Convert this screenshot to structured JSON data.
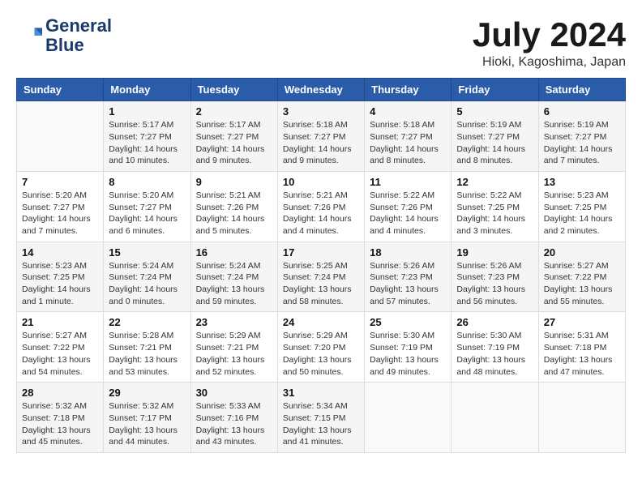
{
  "header": {
    "logo_line1": "General",
    "logo_line2": "Blue",
    "month_year": "July 2024",
    "location": "Hioki, Kagoshima, Japan"
  },
  "weekdays": [
    "Sunday",
    "Monday",
    "Tuesday",
    "Wednesday",
    "Thursday",
    "Friday",
    "Saturday"
  ],
  "weeks": [
    [
      {
        "day": "",
        "info": ""
      },
      {
        "day": "1",
        "info": "Sunrise: 5:17 AM\nSunset: 7:27 PM\nDaylight: 14 hours\nand 10 minutes."
      },
      {
        "day": "2",
        "info": "Sunrise: 5:17 AM\nSunset: 7:27 PM\nDaylight: 14 hours\nand 9 minutes."
      },
      {
        "day": "3",
        "info": "Sunrise: 5:18 AM\nSunset: 7:27 PM\nDaylight: 14 hours\nand 9 minutes."
      },
      {
        "day": "4",
        "info": "Sunrise: 5:18 AM\nSunset: 7:27 PM\nDaylight: 14 hours\nand 8 minutes."
      },
      {
        "day": "5",
        "info": "Sunrise: 5:19 AM\nSunset: 7:27 PM\nDaylight: 14 hours\nand 8 minutes."
      },
      {
        "day": "6",
        "info": "Sunrise: 5:19 AM\nSunset: 7:27 PM\nDaylight: 14 hours\nand 7 minutes."
      }
    ],
    [
      {
        "day": "7",
        "info": "Sunrise: 5:20 AM\nSunset: 7:27 PM\nDaylight: 14 hours\nand 7 minutes."
      },
      {
        "day": "8",
        "info": "Sunrise: 5:20 AM\nSunset: 7:27 PM\nDaylight: 14 hours\nand 6 minutes."
      },
      {
        "day": "9",
        "info": "Sunrise: 5:21 AM\nSunset: 7:26 PM\nDaylight: 14 hours\nand 5 minutes."
      },
      {
        "day": "10",
        "info": "Sunrise: 5:21 AM\nSunset: 7:26 PM\nDaylight: 14 hours\nand 4 minutes."
      },
      {
        "day": "11",
        "info": "Sunrise: 5:22 AM\nSunset: 7:26 PM\nDaylight: 14 hours\nand 4 minutes."
      },
      {
        "day": "12",
        "info": "Sunrise: 5:22 AM\nSunset: 7:25 PM\nDaylight: 14 hours\nand 3 minutes."
      },
      {
        "day": "13",
        "info": "Sunrise: 5:23 AM\nSunset: 7:25 PM\nDaylight: 14 hours\nand 2 minutes."
      }
    ],
    [
      {
        "day": "14",
        "info": "Sunrise: 5:23 AM\nSunset: 7:25 PM\nDaylight: 14 hours\nand 1 minute."
      },
      {
        "day": "15",
        "info": "Sunrise: 5:24 AM\nSunset: 7:24 PM\nDaylight: 14 hours\nand 0 minutes."
      },
      {
        "day": "16",
        "info": "Sunrise: 5:24 AM\nSunset: 7:24 PM\nDaylight: 13 hours\nand 59 minutes."
      },
      {
        "day": "17",
        "info": "Sunrise: 5:25 AM\nSunset: 7:24 PM\nDaylight: 13 hours\nand 58 minutes."
      },
      {
        "day": "18",
        "info": "Sunrise: 5:26 AM\nSunset: 7:23 PM\nDaylight: 13 hours\nand 57 minutes."
      },
      {
        "day": "19",
        "info": "Sunrise: 5:26 AM\nSunset: 7:23 PM\nDaylight: 13 hours\nand 56 minutes."
      },
      {
        "day": "20",
        "info": "Sunrise: 5:27 AM\nSunset: 7:22 PM\nDaylight: 13 hours\nand 55 minutes."
      }
    ],
    [
      {
        "day": "21",
        "info": "Sunrise: 5:27 AM\nSunset: 7:22 PM\nDaylight: 13 hours\nand 54 minutes."
      },
      {
        "day": "22",
        "info": "Sunrise: 5:28 AM\nSunset: 7:21 PM\nDaylight: 13 hours\nand 53 minutes."
      },
      {
        "day": "23",
        "info": "Sunrise: 5:29 AM\nSunset: 7:21 PM\nDaylight: 13 hours\nand 52 minutes."
      },
      {
        "day": "24",
        "info": "Sunrise: 5:29 AM\nSunset: 7:20 PM\nDaylight: 13 hours\nand 50 minutes."
      },
      {
        "day": "25",
        "info": "Sunrise: 5:30 AM\nSunset: 7:19 PM\nDaylight: 13 hours\nand 49 minutes."
      },
      {
        "day": "26",
        "info": "Sunrise: 5:30 AM\nSunset: 7:19 PM\nDaylight: 13 hours\nand 48 minutes."
      },
      {
        "day": "27",
        "info": "Sunrise: 5:31 AM\nSunset: 7:18 PM\nDaylight: 13 hours\nand 47 minutes."
      }
    ],
    [
      {
        "day": "28",
        "info": "Sunrise: 5:32 AM\nSunset: 7:18 PM\nDaylight: 13 hours\nand 45 minutes."
      },
      {
        "day": "29",
        "info": "Sunrise: 5:32 AM\nSunset: 7:17 PM\nDaylight: 13 hours\nand 44 minutes."
      },
      {
        "day": "30",
        "info": "Sunrise: 5:33 AM\nSunset: 7:16 PM\nDaylight: 13 hours\nand 43 minutes."
      },
      {
        "day": "31",
        "info": "Sunrise: 5:34 AM\nSunset: 7:15 PM\nDaylight: 13 hours\nand 41 minutes."
      },
      {
        "day": "",
        "info": ""
      },
      {
        "day": "",
        "info": ""
      },
      {
        "day": "",
        "info": ""
      }
    ]
  ]
}
